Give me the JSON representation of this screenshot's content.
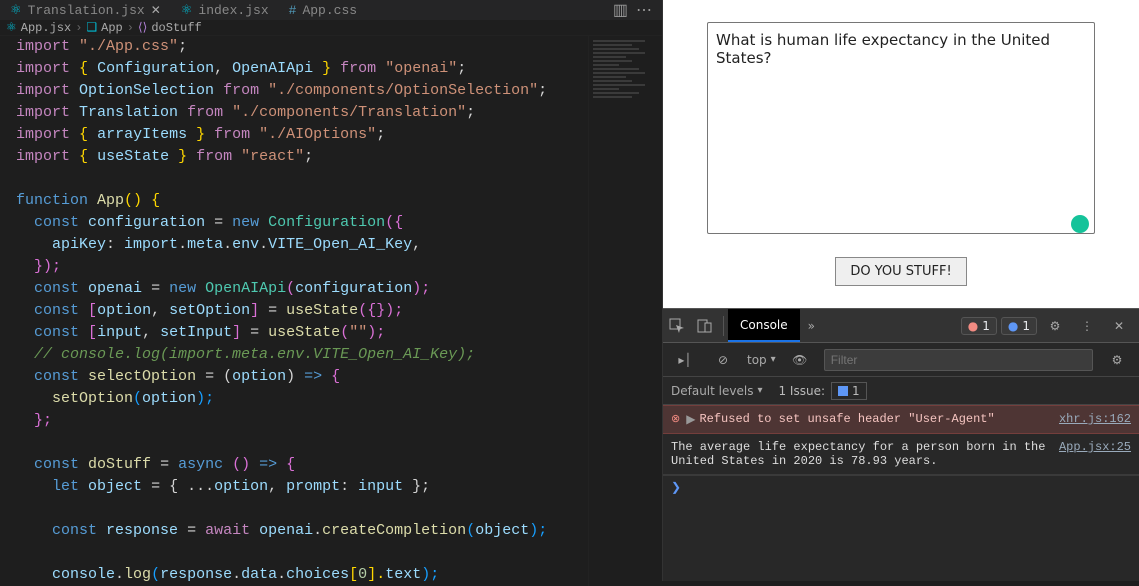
{
  "tabs": [
    {
      "label": "Translation.jsx"
    },
    {
      "label": "index.jsx"
    },
    {
      "label": "App.css"
    }
  ],
  "breadcrumb": {
    "file": "App.jsx",
    "comp": "App",
    "method": "doStuff"
  },
  "code": {
    "l1a": "import",
    "l1b": "\"./App.css\"",
    "l1c": ";",
    "l2a": "import",
    "l2b": "{",
    "l2c": "Configuration",
    "l2d": ", ",
    "l2e": "OpenAIApi",
    "l2f": "}",
    "l2g": "from",
    "l2h": "\"openai\"",
    "l2i": ";",
    "l3a": "import",
    "l3b": "OptionSelection",
    "l3c": "from",
    "l3d": "\"./components/OptionSelection\"",
    "l3e": ";",
    "l4a": "import",
    "l4b": "Translation",
    "l4c": "from",
    "l4d": "\"./components/Translation\"",
    "l4e": ";",
    "l5a": "import",
    "l5b": "{",
    "l5c": "arrayItems",
    "l5d": "}",
    "l5e": "from",
    "l5f": "\"./AIOptions\"",
    "l5g": ";",
    "l6a": "import",
    "l6b": "{",
    "l6c": "useState",
    "l6d": "}",
    "l6e": "from",
    "l6f": "\"react\"",
    "l6g": ";",
    "l8a": "function",
    "l8b": "App",
    "l8c": "()",
    "l8d": "{",
    "l9a": "const",
    "l9b": "configuration",
    "l9c": "=",
    "l9d": "new",
    "l9e": "Configuration",
    "l9f": "({",
    "l10a": "apiKey",
    "l10b": ": ",
    "l10c": "import",
    "l10d": ".",
    "l10e": "meta",
    "l10f": ".",
    "l10g": "env",
    "l10h": ".",
    "l10i": "VITE_Open_AI_Key",
    "l10j": ",",
    "l11a": "});",
    "l12a": "const",
    "l12b": "openai",
    "l12c": "=",
    "l12d": "new",
    "l12e": "OpenAIApi",
    "l12f": "(",
    "l12g": "configuration",
    "l12h": ");",
    "l13a": "const",
    "l13b": "[",
    "l13c": "option",
    "l13d": ", ",
    "l13e": "setOption",
    "l13f": "]",
    "l13g": "=",
    "l13h": "useState",
    "l13i": "({});",
    "l14a": "const",
    "l14b": "[",
    "l14c": "input",
    "l14d": ", ",
    "l14e": "setInput",
    "l14f": "]",
    "l14g": "=",
    "l14h": "useState",
    "l14i": "(",
    "l14j": "\"\"",
    "l14k": ");",
    "l15": "// console.log(import.meta.env.VITE_Open_AI_Key);",
    "l16a": "const",
    "l16b": "selectOption",
    "l16c": "= (",
    "l16d": "option",
    "l16e": ") ",
    "l16f": "=>",
    "l16g": " {",
    "l17a": "setOption",
    "l17b": "(",
    "l17c": "option",
    "l17d": ");",
    "l18a": "};",
    "l20a": "const",
    "l20b": "doStuff",
    "l20c": "= ",
    "l20d": "async",
    "l20e": " () ",
    "l20f": "=>",
    "l20g": " {",
    "l21a": "let",
    "l21b": "object",
    "l21c": "= { ...",
    "l21d": "option",
    "l21e": ", ",
    "l21f": "prompt",
    "l21g": ": ",
    "l21h": "input",
    "l21i": " };",
    "l23a": "const",
    "l23b": "response",
    "l23c": "= ",
    "l23d": "await",
    "l23e": " ",
    "l23f": "openai",
    "l23g": ".",
    "l23h": "createCompletion",
    "l23i": "(",
    "l23j": "object",
    "l23k": ");",
    "l25a": "console",
    "l25b": ".",
    "l25c": "log",
    "l25d": "(",
    "l25e": "response",
    "l25f": ".",
    "l25g": "data",
    "l25h": ".",
    "l25i": "choices",
    "l25j": "[",
    "l25k": "0",
    "l25l": "].",
    "l25m": "text",
    "l25n": ");"
  },
  "preview": {
    "textarea_value": "What is human life expectancy in the United States?",
    "button_label": "DO YOU STUFF!"
  },
  "devtools": {
    "tab_console": "Console",
    "err_count": "1",
    "msg_count": "1",
    "top": "top",
    "filter_ph": "Filter",
    "default_levels": "Default levels",
    "issue_label": "1 Issue:",
    "issue_count": "1",
    "error_msg": "Refused to set unsafe header \"User-Agent\"",
    "error_src": "xhr.js:162",
    "log_src": "App.jsx:25",
    "log_msg": "The average life expectancy for a person born in the United States in 2020 is 78.93 years."
  }
}
